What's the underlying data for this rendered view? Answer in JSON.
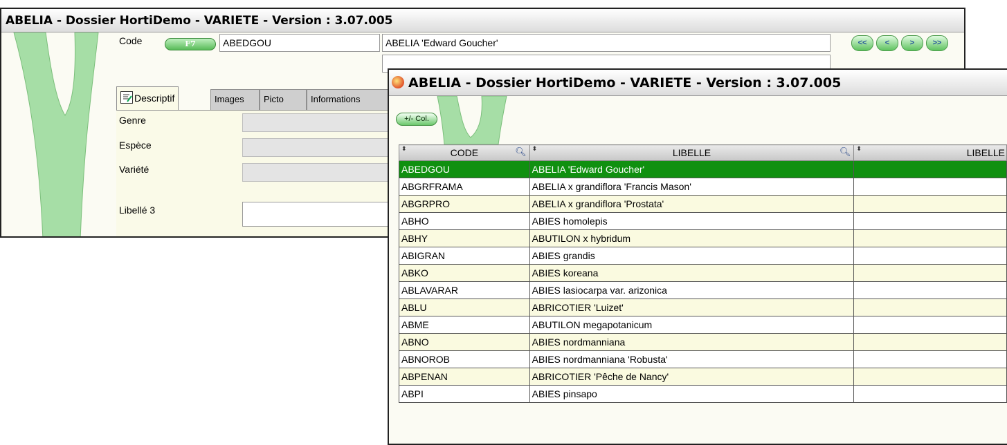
{
  "window1": {
    "title": "ABELIA  -  Dossier HortiDemo  -  VARIETE  -  Version : 3.07.005",
    "code_label": "Code",
    "f7_label": "F7",
    "code_value": "ABEDGOU",
    "libelle_value": "ABELIA 'Edward Goucher'",
    "nav": [
      "<<",
      "<",
      ">",
      ">>"
    ],
    "tabs": [
      "Descriptif",
      "Images",
      "Picto",
      "Informations"
    ],
    "fields": [
      "Genre",
      "Espèce",
      "Variété",
      "Libellé 3"
    ]
  },
  "window2": {
    "title": "ABELIA  -  Dossier HortiDemo  -  VARIETE  -  Version : 3.07.005",
    "col_button": "+/- Col.",
    "headers": [
      "CODE",
      "LIBELLE",
      "LIBELLE"
    ],
    "selected_row": 0,
    "rows": [
      [
        "ABEDGOU",
        "ABELIA 'Edward Goucher'",
        ""
      ],
      [
        "ABGRFRAMA",
        "ABELIA x grandiflora 'Francis Mason'",
        ""
      ],
      [
        "ABGRPRO",
        "ABELIA x grandiflora 'Prostata'",
        ""
      ],
      [
        "ABHO",
        "ABIES homolepis",
        ""
      ],
      [
        "ABHY",
        "ABUTILON x hybridum",
        ""
      ],
      [
        "ABIGRAN",
        "ABIES grandis",
        ""
      ],
      [
        "ABKO",
        "ABIES koreana",
        ""
      ],
      [
        "ABLAVARAR",
        "ABIES lasiocarpa var. arizonica",
        ""
      ],
      [
        "ABLU",
        "ABRICOTIER 'Luizet'",
        ""
      ],
      [
        "ABME",
        "ABUTILON megapotanicum",
        ""
      ],
      [
        "ABNO",
        "ABIES nordmanniana",
        ""
      ],
      [
        "ABNOROB",
        "ABIES nordmanniana 'Robusta'",
        ""
      ],
      [
        "ABPENAN",
        "ABRICOTIER 'Pêche de Nancy'",
        ""
      ],
      [
        "ABPI",
        "ABIES pinsapo",
        ""
      ]
    ]
  }
}
